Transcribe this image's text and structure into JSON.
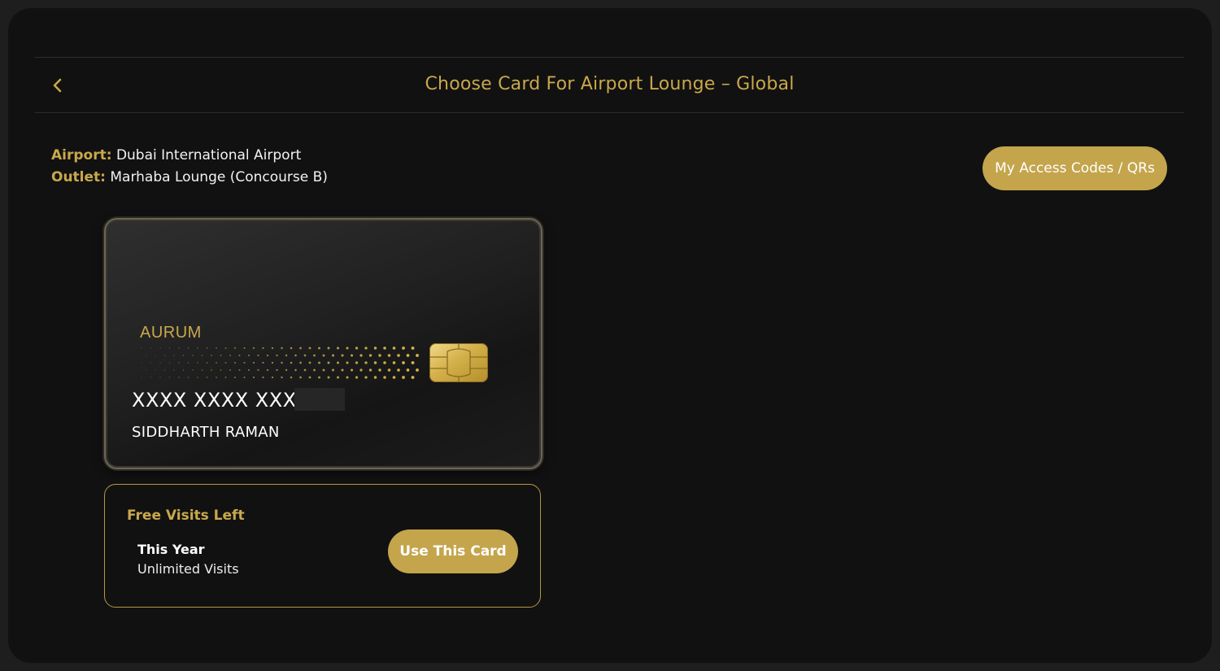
{
  "header": {
    "title": "Choose Card For Airport Lounge – Global",
    "back_icon": "chevron-left-icon"
  },
  "info": {
    "airport_label": "Airport:",
    "airport_value": "Dubai International Airport",
    "outlet_label": "Outlet:",
    "outlet_value": "Marhaba Lounge (Concourse B)"
  },
  "access_button": {
    "label": "My Access Codes / QRs"
  },
  "card": {
    "brand": "AURUM",
    "number": "XXXX XXXX XXXX",
    "holder": "SIDDHARTH RAMAN"
  },
  "visits": {
    "title": "Free Visits Left",
    "period": "This Year",
    "value": "Unlimited Visits",
    "use_button": "Use This Card"
  },
  "colors": {
    "accent": "#c9a84c",
    "button": "#c4a54c",
    "background": "#111111"
  }
}
